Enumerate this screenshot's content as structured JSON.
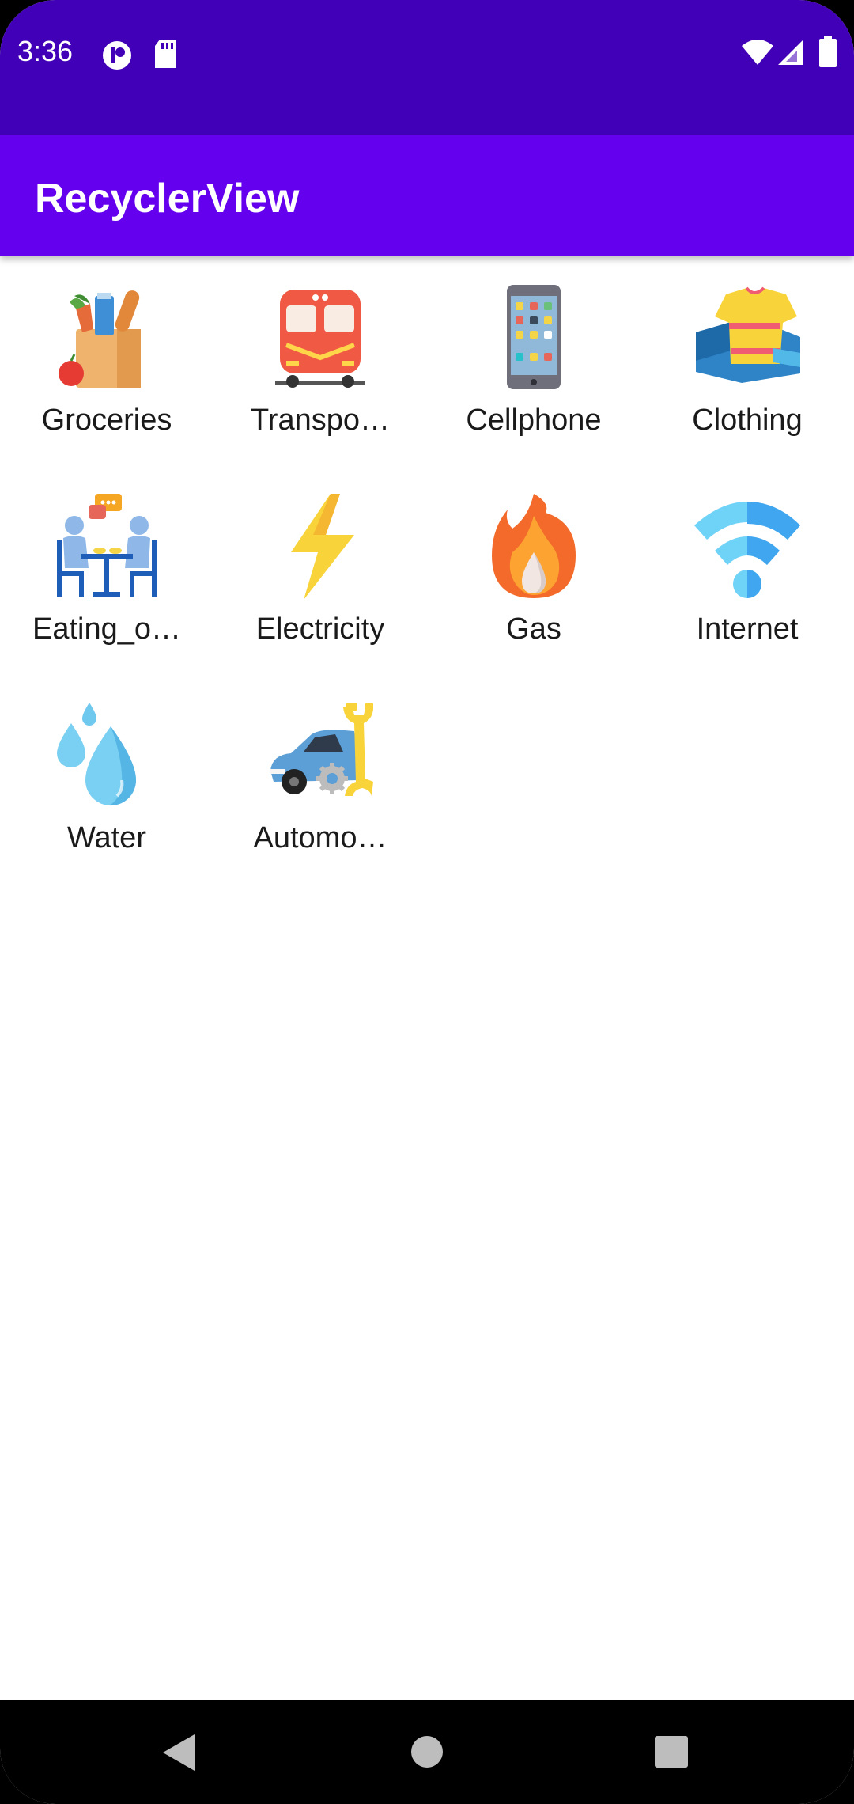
{
  "status_bar": {
    "time": "3:36",
    "left_icons": [
      "app-notification-icon",
      "sd-card-icon"
    ],
    "right_icons": [
      "wifi-icon",
      "signal-icon",
      "battery-icon"
    ]
  },
  "app_bar": {
    "title": "RecyclerView"
  },
  "items": [
    {
      "label": "Groceries",
      "icon": "groceries-icon"
    },
    {
      "label": "Transpo…",
      "icon": "train-icon"
    },
    {
      "label": "Cellphone",
      "icon": "cellphone-icon"
    },
    {
      "label": "Clothing",
      "icon": "clothing-icon"
    },
    {
      "label": "Eating_o…",
      "icon": "eating-out-icon"
    },
    {
      "label": "Electricity",
      "icon": "lightning-icon"
    },
    {
      "label": "Gas",
      "icon": "flame-icon"
    },
    {
      "label": "Internet",
      "icon": "wifi-icon"
    },
    {
      "label": "Water",
      "icon": "water-drops-icon"
    },
    {
      "label": "Automo…",
      "icon": "car-repair-icon"
    }
  ],
  "nav_bar": {
    "buttons": [
      "back-icon",
      "home-icon",
      "recents-icon"
    ]
  },
  "colors": {
    "status_bar": "#4100b8",
    "app_bar": "#6400ee",
    "background": "#ffffff",
    "nav_bar": "#000000"
  }
}
